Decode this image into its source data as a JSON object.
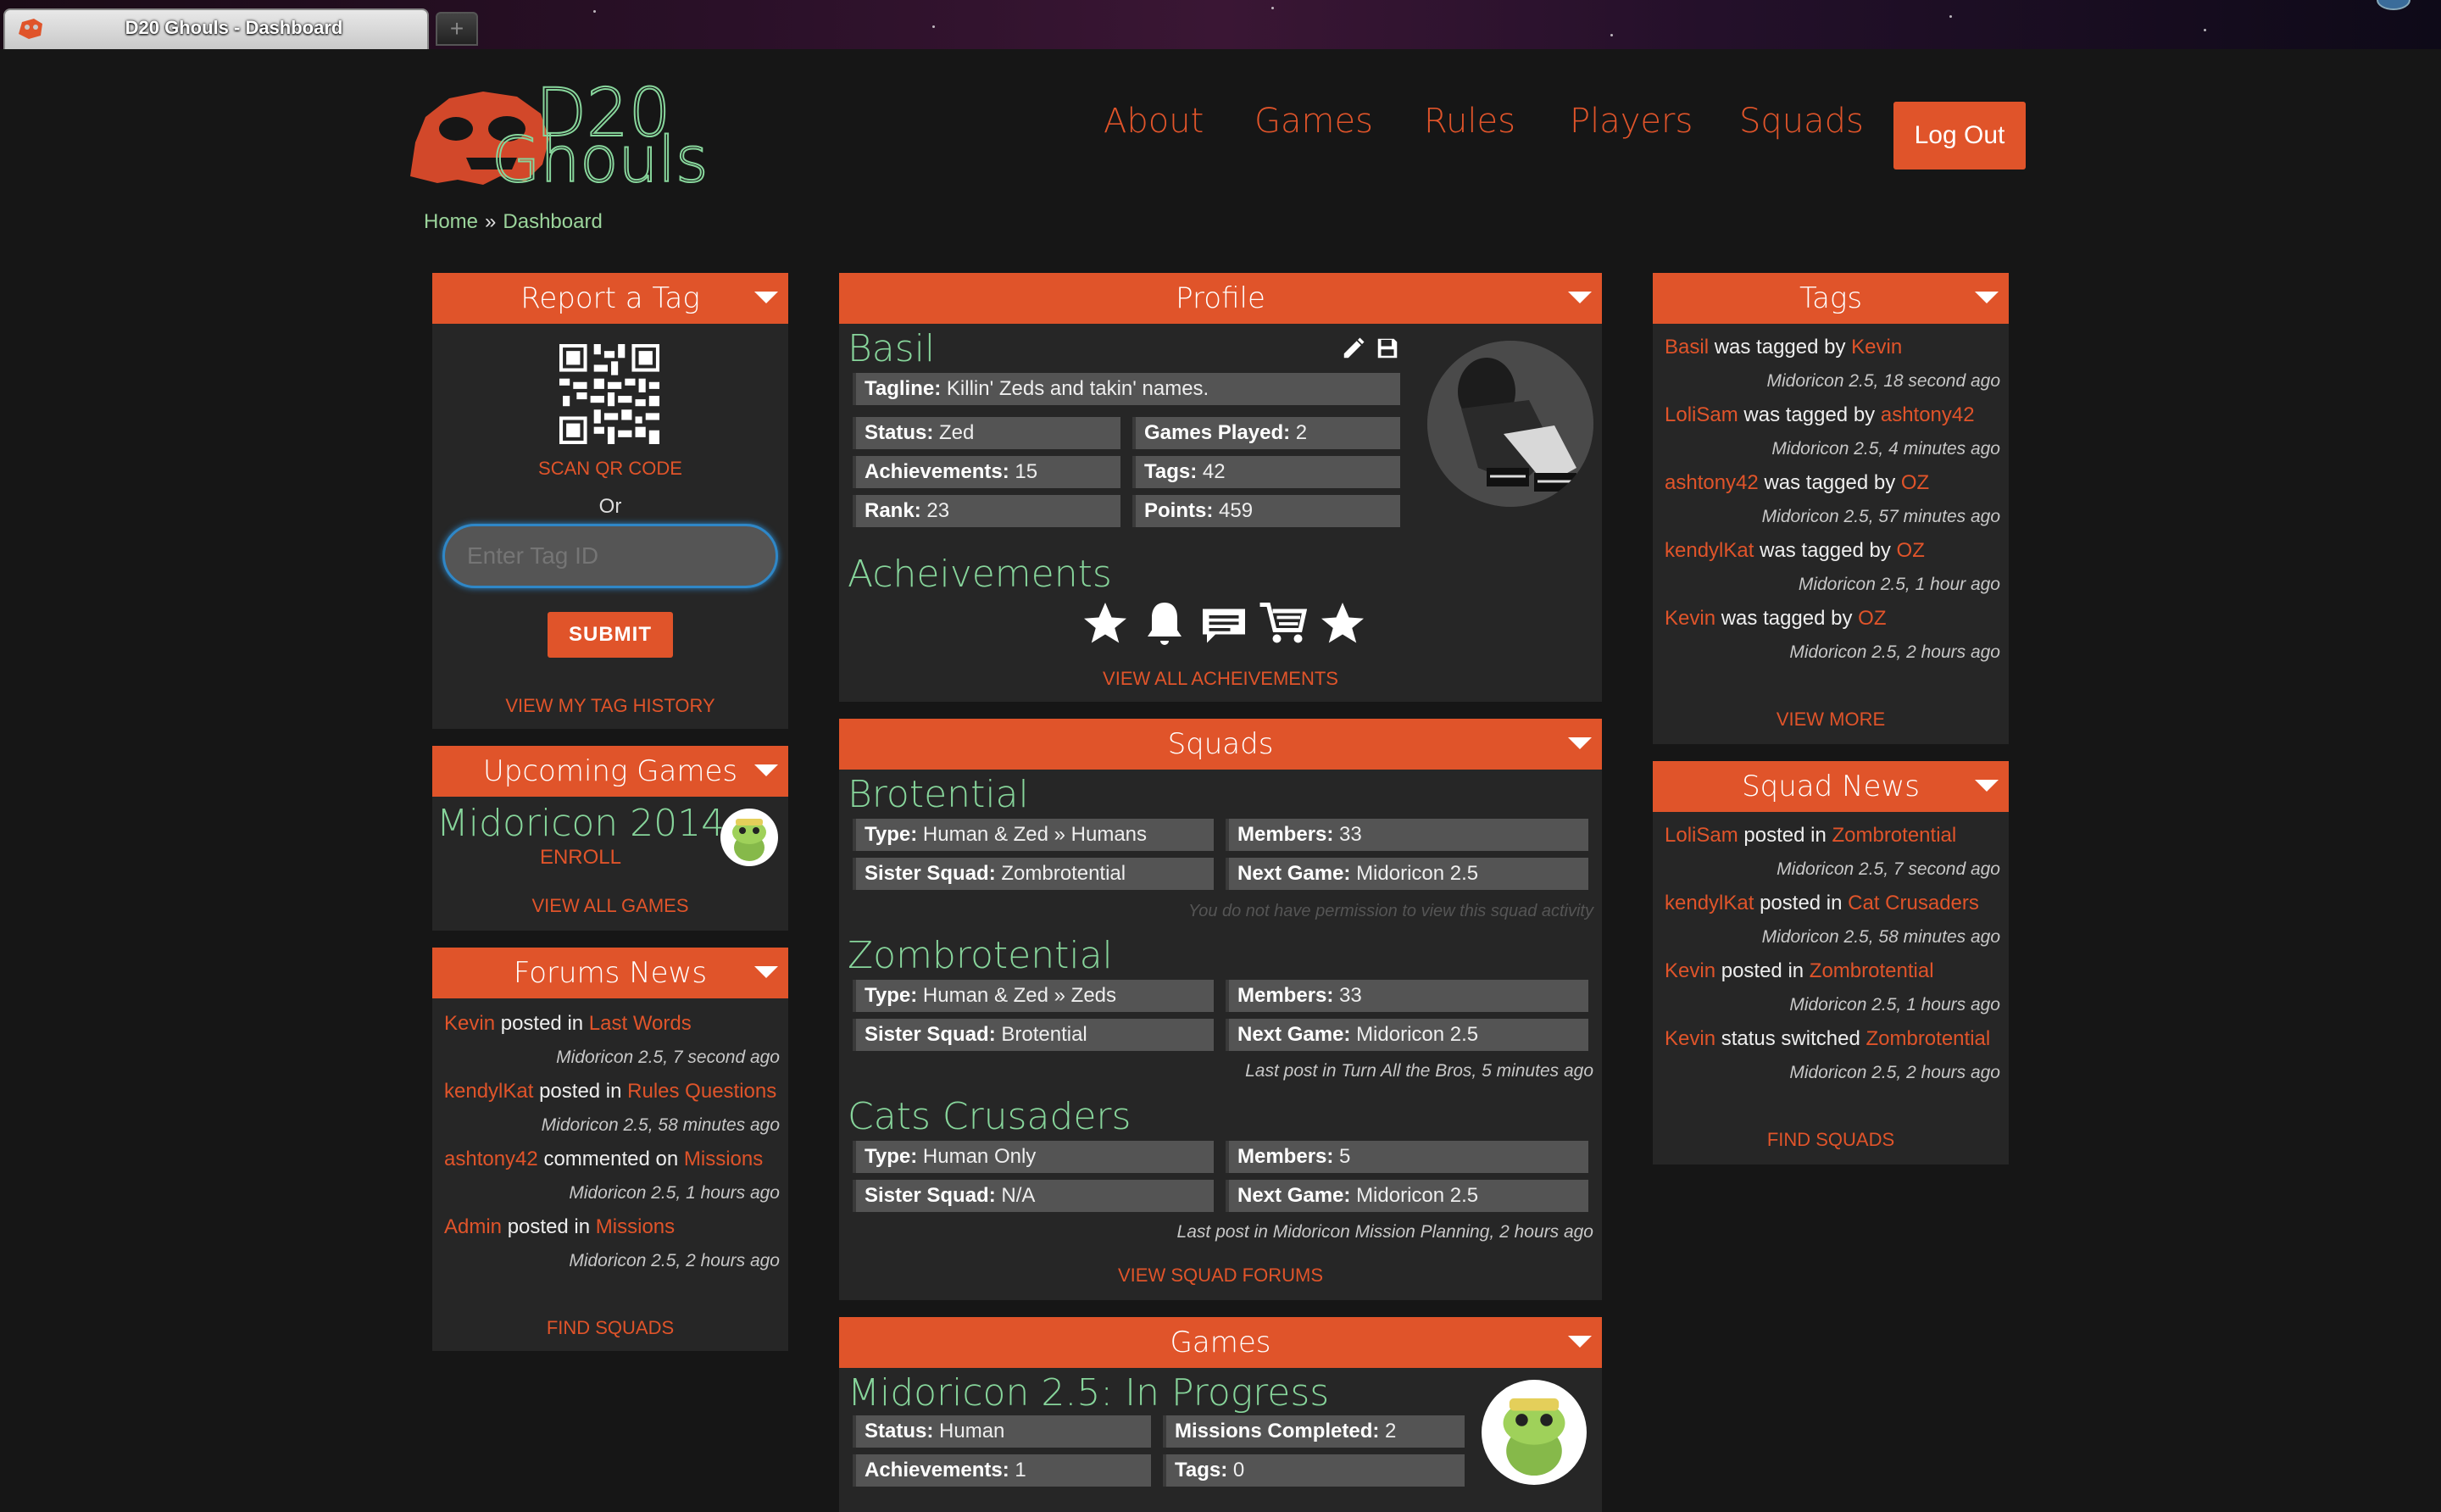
{
  "browser": {
    "tab_title": "D20 Ghouls - Dashboard",
    "new_tab": "+"
  },
  "logo": {
    "line1": "D20",
    "line2": "Ghouls"
  },
  "nav": {
    "about": "About",
    "games": "Games",
    "rules": "Rules",
    "players": "Players",
    "squads": "Squads",
    "logout": "Log Out"
  },
  "breadcrumb": {
    "home": "Home",
    "sep": "»",
    "current": "Dashboard"
  },
  "report_tag": {
    "title": "Report a Tag",
    "scan": "SCAN QR CODE",
    "or": "Or",
    "placeholder": "Enter Tag ID",
    "submit": "SUBMIT",
    "history": "VIEW MY TAG HISTORY"
  },
  "upcoming": {
    "title": "Upcoming Games",
    "game": "Midoricon 2014",
    "enroll": "ENROLL",
    "view_all": "VIEW ALL GAMES"
  },
  "forums": {
    "title": "Forums News",
    "items": [
      {
        "user": "Kevin",
        "action": "posted in",
        "target": "Last Words",
        "meta": "Midoricon 2.5, 7 second ago"
      },
      {
        "user": "kendylKat",
        "action": "posted in",
        "target": "Rules Questions",
        "meta": "Midoricon 2.5, 58 minutes ago"
      },
      {
        "user": "ashtony42",
        "action": "commented on",
        "target": "Missions",
        "meta": "Midoricon 2.5, 1 hours ago"
      },
      {
        "user": "Admin",
        "action": "posted in",
        "target": "Missions",
        "meta": "Midoricon 2.5, 2 hours ago"
      }
    ],
    "footer": "FIND SQUADS"
  },
  "profile": {
    "title": "Profile",
    "name": "Basil",
    "tagline_label": "Tagline:",
    "tagline": "Killin' Zeds and takin' names.",
    "status_label": "Status:",
    "status": "Zed",
    "games_played_label": "Games Played:",
    "games_played": "2",
    "achievements_label": "Achievements:",
    "achievements": "15",
    "tags_label": "Tags:",
    "tags": "42",
    "rank_label": "Rank:",
    "rank": "23",
    "points_label": "Points:",
    "points": "459",
    "ach_heading": "Acheivements",
    "ach_icons": [
      "star-icon",
      "bell-icon",
      "message-icon",
      "cart-icon",
      "star-icon"
    ],
    "view_all": "VIEW ALL ACHEIVEMENTS"
  },
  "squads": {
    "title": "Squads",
    "list": [
      {
        "name": "Brotential",
        "type_label": "Type:",
        "type": "Human & Zed » Humans",
        "members_label": "Members:",
        "members": "33",
        "sister_label": "Sister Squad:",
        "sister": "Zombrotential",
        "next_label": "Next Game:",
        "next": "Midoricon 2.5",
        "note": "You do not have permission to view this squad activity"
      },
      {
        "name": "Zombrotential",
        "type_label": "Type:",
        "type": "Human & Zed » Zeds",
        "members_label": "Members:",
        "members": "33",
        "sister_label": "Sister Squad:",
        "sister": "Brotential",
        "next_label": "Next Game:",
        "next": "Midoricon 2.5",
        "note": "Last post in Turn All the Bros, 5 minutes ago"
      },
      {
        "name": "Cats Crusaders",
        "type_label": "Type:",
        "type": "Human Only",
        "members_label": "Members:",
        "members": "5",
        "sister_label": "Sister Squad:",
        "sister": "N/A",
        "next_label": "Next Game:",
        "next": "Midoricon 2.5",
        "note": "Last post in Midoricon Mission Planning, 2 hours ago"
      }
    ],
    "footer": "VIEW SQUAD FORUMS"
  },
  "games": {
    "title": "Games",
    "current": "Midoricon 2.5: In Progress",
    "status_label": "Status:",
    "status": "Human",
    "missions_label": "Missions Completed:",
    "missions": "2",
    "achievements_label": "Achievements:",
    "achievements": "1",
    "tags_label": "Tags:",
    "tags": "0"
  },
  "tags": {
    "title": "Tags",
    "items": [
      {
        "tagged": "Basil",
        "action": "was tagged by",
        "by": "Kevin",
        "meta": "Midoricon 2.5, 18 second ago"
      },
      {
        "tagged": "LoliSam",
        "action": "was tagged by",
        "by": "ashtony42",
        "meta": "Midoricon 2.5, 4 minutes ago"
      },
      {
        "tagged": "ashtony42",
        "action": "was tagged by",
        "by": "OZ",
        "meta": "Midoricon 2.5, 57 minutes ago"
      },
      {
        "tagged": "kendylKat",
        "action": "was tagged by",
        "by": "OZ",
        "meta": "Midoricon 2.5, 1 hour ago"
      },
      {
        "tagged": "Kevin",
        "action": "was tagged by",
        "by": "OZ",
        "meta": "Midoricon 2.5, 2 hours ago"
      }
    ],
    "footer": "VIEW MORE"
  },
  "squad_news": {
    "title": "Squad News",
    "items": [
      {
        "user": "LoliSam",
        "action": "posted in",
        "target": "Zombrotential",
        "meta": "Midoricon 2.5, 7 second ago"
      },
      {
        "user": "kendylKat",
        "action": "posted in",
        "target": "Cat Crusaders",
        "meta": "Midoricon 2.5, 58 minutes ago"
      },
      {
        "user": "Kevin",
        "action": "posted in",
        "target": "Zombrotential",
        "meta": "Midoricon 2.5, 1 hours ago"
      },
      {
        "user": "Kevin",
        "action": "status switched",
        "target": "Zombrotential",
        "meta": "Midoricon 2.5, 2 hours ago"
      }
    ],
    "footer": "FIND SQUADS"
  },
  "colors": {
    "accent": "#e0542a",
    "green": "#87d59b",
    "panel": "#262626",
    "field": "#545454",
    "background": "#161616"
  }
}
